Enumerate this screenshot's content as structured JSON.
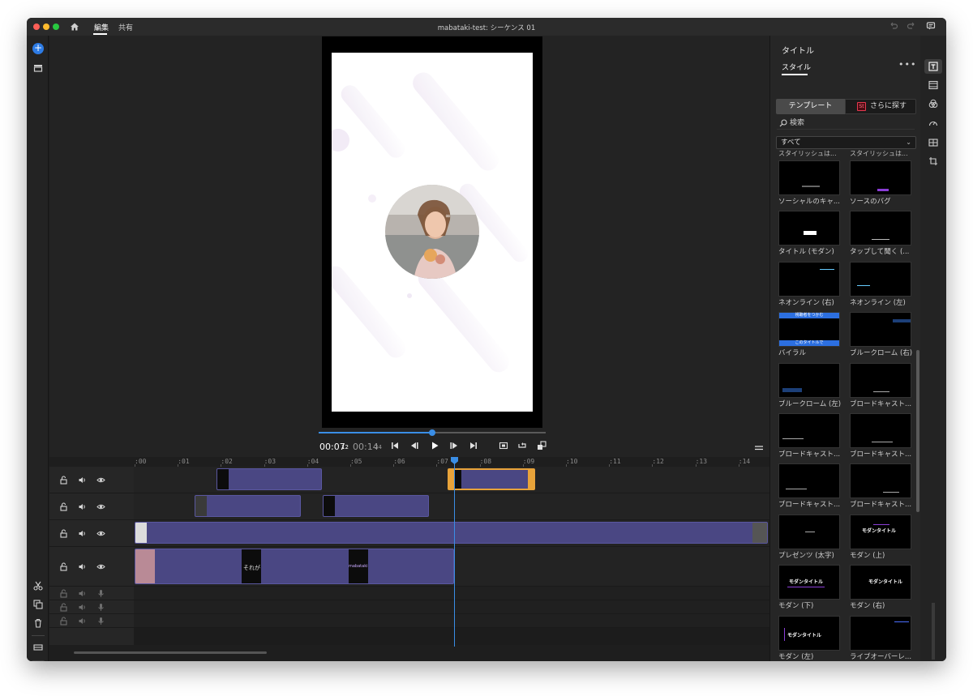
{
  "window": {
    "title": "mabataki-test: シーケンス 01"
  },
  "titlebar": {
    "tabs": [
      {
        "label": "編集"
      },
      {
        "label": "共有"
      }
    ]
  },
  "player": {
    "current_time": "00:07",
    "current_frames": "12",
    "total_time": "00:14",
    "total_frames": "24",
    "progress": 0.5
  },
  "timeline": {
    "ruler": [
      ":00",
      ":01",
      ":02",
      ":03",
      ":04",
      ":05",
      ":06",
      ":07",
      ":08",
      ":09",
      ":10",
      ":11",
      ":12",
      ":13",
      ":14"
    ],
    "clip_texts": {
      "caption_1": "それが",
      "caption_2": "mabataki"
    }
  },
  "right_panel": {
    "title": "タイトル",
    "tab": "スタイル",
    "more": "•••",
    "segment_template": "テンプレート",
    "segment_find": "さらに探す",
    "stock_badge": "St",
    "search_placeholder": "検索",
    "filter_value": "すべて",
    "tiles": [
      {
        "label": "ソーシャルのキャ..."
      },
      {
        "label": "ソースのバグ"
      },
      {
        "label": "タイトル (モダン)"
      },
      {
        "label": "タップして聞く (..."
      },
      {
        "label": "ネオンライン (右)"
      },
      {
        "label": "ネオンライン (左)"
      },
      {
        "label": "バイラル"
      },
      {
        "label": "ブルークローム (右)"
      },
      {
        "label": "ブルークローム (左)"
      },
      {
        "label": "ブロードキャスト..."
      },
      {
        "label": "ブロードキャスト..."
      },
      {
        "label": "ブロードキャスト..."
      },
      {
        "label": "ブロードキャスト..."
      },
      {
        "label": "ブロードキャスト..."
      },
      {
        "label": "プレゼンツ (太字)"
      },
      {
        "label": "モダン (上)"
      },
      {
        "label": "モダン (下)"
      },
      {
        "label": "モダン (右)"
      },
      {
        "label": "モダン (左)"
      },
      {
        "label": "ライブオーバーレ..."
      }
    ],
    "tile_texts": {
      "modern_title": "モダンタイトル",
      "viral_top": "視聴者をつかむ",
      "viral_bottom": "このタイトルで"
    }
  },
  "colors": {
    "accent": "#3a8ee6",
    "clip": "#4a4783",
    "selected_clip": "#e8a33a",
    "window_bg": "#1e1e1e"
  },
  "icons": [
    "home-icon",
    "undo-icon",
    "redo-icon",
    "comment-icon",
    "add-icon",
    "media-icon",
    "scissors-icon",
    "duplicate-icon",
    "trash-icon",
    "track-icon",
    "list-icon",
    "lock-icon",
    "speaker-icon",
    "eye-icon",
    "mic-icon",
    "go-start-icon",
    "step-back-icon",
    "play-icon",
    "step-forward-icon",
    "go-end-icon",
    "fit-icon",
    "loop-icon",
    "export-icon",
    "menu-icon",
    "search-icon",
    "chevron-down-icon",
    "titles-icon",
    "video-icon",
    "color-icon",
    "speed-icon",
    "layout-icon",
    "crop-icon"
  ]
}
